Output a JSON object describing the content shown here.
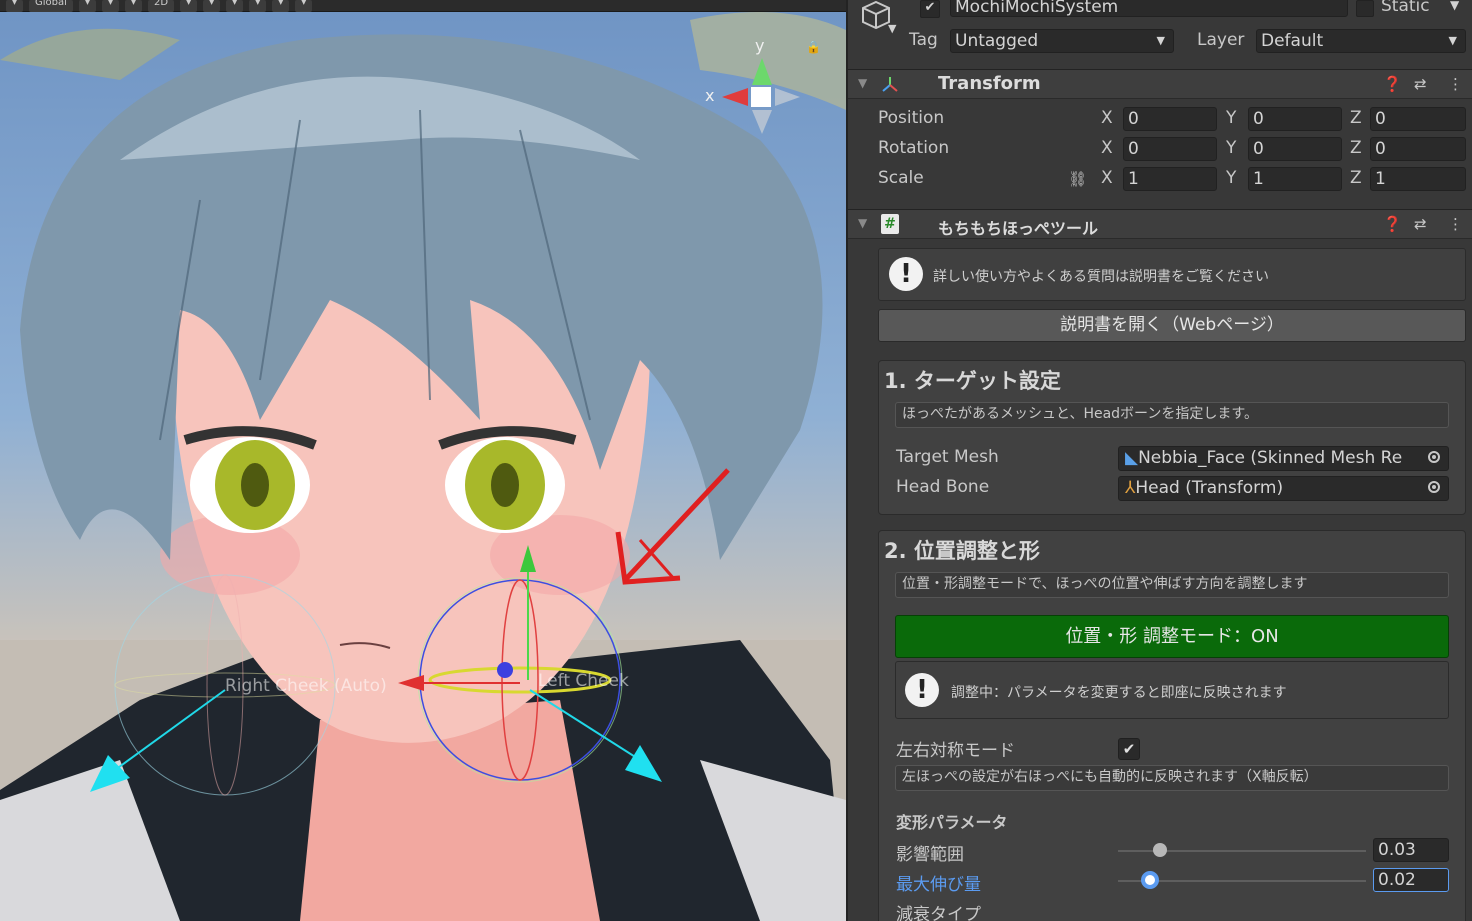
{
  "scene": {
    "toolbar": {
      "global_label": "Global",
      "mode_2d": "2D"
    },
    "gizmo_axis_y": "y",
    "gizmo_axis_x": "x",
    "right_cheek_label": "Right Cheek (Auto)",
    "left_cheek_label": "Left Cheek"
  },
  "inspector": {
    "object_name": "MochiMochiSystem",
    "static_label": "Static",
    "tag_label": "Tag",
    "tag_value": "Untagged",
    "layer_label": "Layer",
    "layer_value": "Default",
    "transform": {
      "title": "Transform",
      "position_label": "Position",
      "rotation_label": "Rotation",
      "scale_label": "Scale",
      "axis_x": "X",
      "axis_y": "Y",
      "axis_z": "Z",
      "position": [
        "0",
        "0",
        "0"
      ],
      "rotation": [
        "0",
        "0",
        "0"
      ],
      "scale": [
        "1",
        "1",
        "1"
      ]
    },
    "tool": {
      "title": "もちもちほっぺツール",
      "help_text": "詳しい使い方やよくある質問は説明書をご覧ください",
      "open_manual_button": "説明書を開く（Webページ）",
      "section1": {
        "title": "1. ターゲット設定",
        "desc": "ほっぺたがあるメッシュと、Headボーンを指定します。",
        "target_mesh_label": "Target Mesh",
        "target_mesh_value": "Nebbia_Face (Skinned Mesh Re",
        "head_bone_label": "Head Bone",
        "head_bone_value": "Head (Transform)"
      },
      "section2": {
        "title": "2. 位置調整と形",
        "desc": "位置・形調整モードで、ほっぺの位置や伸ばす方向を調整します",
        "mode_button": "位置・形 調整モード：ON",
        "adjust_help": "調整中：パラメータを変更すると即座に反映されます",
        "symmetry_label": "左右対称モード",
        "symmetry_checked": true,
        "symmetry_desc": "左ほっぺの設定が右ほっぺにも自動的に反映されます（X軸反転）",
        "params_title": "変形パラメータ",
        "influence_label": "影響範囲",
        "influence_value": "0.03",
        "influence_fraction": 0.17,
        "max_stretch_label": "最大伸び量",
        "max_stretch_value": "0.02",
        "max_stretch_fraction": 0.13,
        "falloff_label": "減衰タイプ"
      }
    },
    "colors": {
      "accent_green": "#0a6a0a",
      "accent_blue": "#5b9bf0"
    }
  }
}
